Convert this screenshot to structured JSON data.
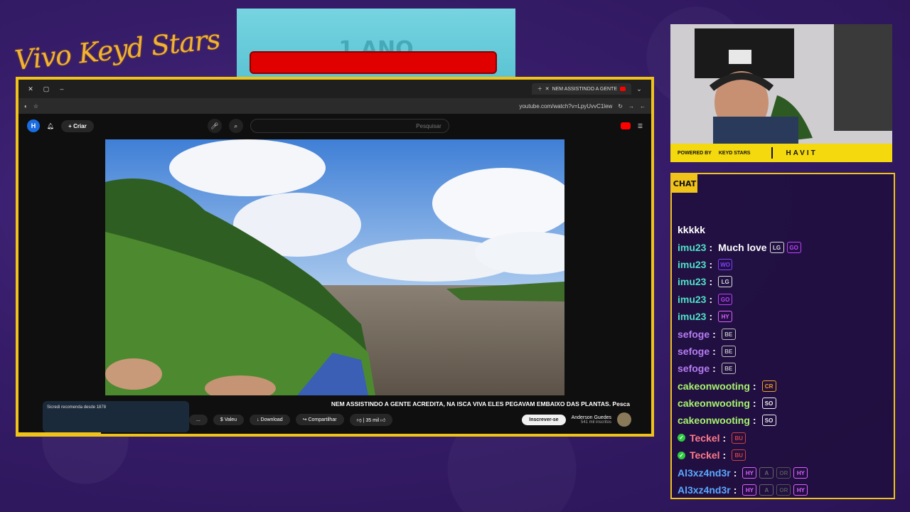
{
  "overlay": {
    "logo_text": "Vivo Keyd Stars",
    "banner_text": "1 ANO",
    "powered_by": "POWERED BY",
    "partner_1": "KEYD STARS",
    "partner_2": "HAVIT",
    "chat_label": "CHAT"
  },
  "browser": {
    "tab_title": "NEM ASSISTINDO A GENTE",
    "url": "youtube.com/watch?v=LpyUvvC1lew",
    "search_placeholder": "Pesquisar",
    "create_label": "Criar",
    "avatar_letter": "H"
  },
  "video": {
    "title": "NEM ASSISTINDO A GENTE ACREDITA, NA ISCA VIVA ELES PEGAVAM EMBAIXO DAS PLANTAS. Pesca",
    "channel_name": "Anderson Guedes",
    "subscribers": "541 mil inscritos",
    "subscribe_label": "Inscrever-se",
    "likes": "35 mil",
    "share_label": "Compartilhar",
    "download_label": "Download",
    "thanks_label": "Valeu",
    "more_label": "...",
    "ad_text": "Sicredi recomenda desde 1878"
  },
  "chat": {
    "messages": [
      {
        "user": "",
        "color": "#ffffff",
        "text": "kkkkk",
        "emotes": [],
        "badge": false
      },
      {
        "user": "imu23",
        "color": "#4fe0c6",
        "text": "Much love",
        "emotes": [
          "LG",
          "GOOD"
        ],
        "badge": false
      },
      {
        "user": "imu23",
        "color": "#4fe0c6",
        "text": "",
        "emotes": [
          "WOW"
        ],
        "badge": false
      },
      {
        "user": "imu23",
        "color": "#4fe0c6",
        "text": "",
        "emotes": [
          "LG"
        ],
        "badge": false
      },
      {
        "user": "imu23",
        "color": "#4fe0c6",
        "text": "",
        "emotes": [
          "GOOD"
        ],
        "badge": false
      },
      {
        "user": "imu23",
        "color": "#4fe0c6",
        "text": "",
        "emotes": [
          "HYPE"
        ],
        "badge": false
      },
      {
        "user": "sefoge",
        "color": "#b57cf2",
        "text": "",
        "emotes": [
          "BEER"
        ],
        "badge": false
      },
      {
        "user": "sefoge",
        "color": "#b57cf2",
        "text": "",
        "emotes": [
          "BEER"
        ],
        "badge": false
      },
      {
        "user": "sefoge",
        "color": "#b57cf2",
        "text": "",
        "emotes": [
          "BEER"
        ],
        "badge": false
      },
      {
        "user": "cakeonwooting",
        "color": "#a7f26e",
        "text": "",
        "emotes": [
          "CROWN"
        ],
        "badge": false
      },
      {
        "user": "cakeonwooting",
        "color": "#a7f26e",
        "text": "",
        "emotes": [
          "SOCK"
        ],
        "badge": false
      },
      {
        "user": "cakeonwooting",
        "color": "#a7f26e",
        "text": "",
        "emotes": [
          "SOCK"
        ],
        "badge": false
      },
      {
        "user": "Teckel",
        "color": "#ff7b8a",
        "text": "",
        "emotes": [
          "BUS"
        ],
        "badge": true
      },
      {
        "user": "Teckel",
        "color": "#ff7b8a",
        "text": "",
        "emotes": [
          "BUS"
        ],
        "badge": true
      },
      {
        "user": "Al3xz4nd3r",
        "color": "#5aa9ff",
        "text": "",
        "emotes": [
          "HYPE",
          "A",
          "ORK",
          "HYPE"
        ],
        "badge": false
      },
      {
        "user": "Al3xz4nd3r",
        "color": "#5aa9ff",
        "text": "",
        "emotes": [
          "HYPE",
          "A",
          "ORK",
          "HYPE"
        ],
        "badge": false
      }
    ]
  }
}
